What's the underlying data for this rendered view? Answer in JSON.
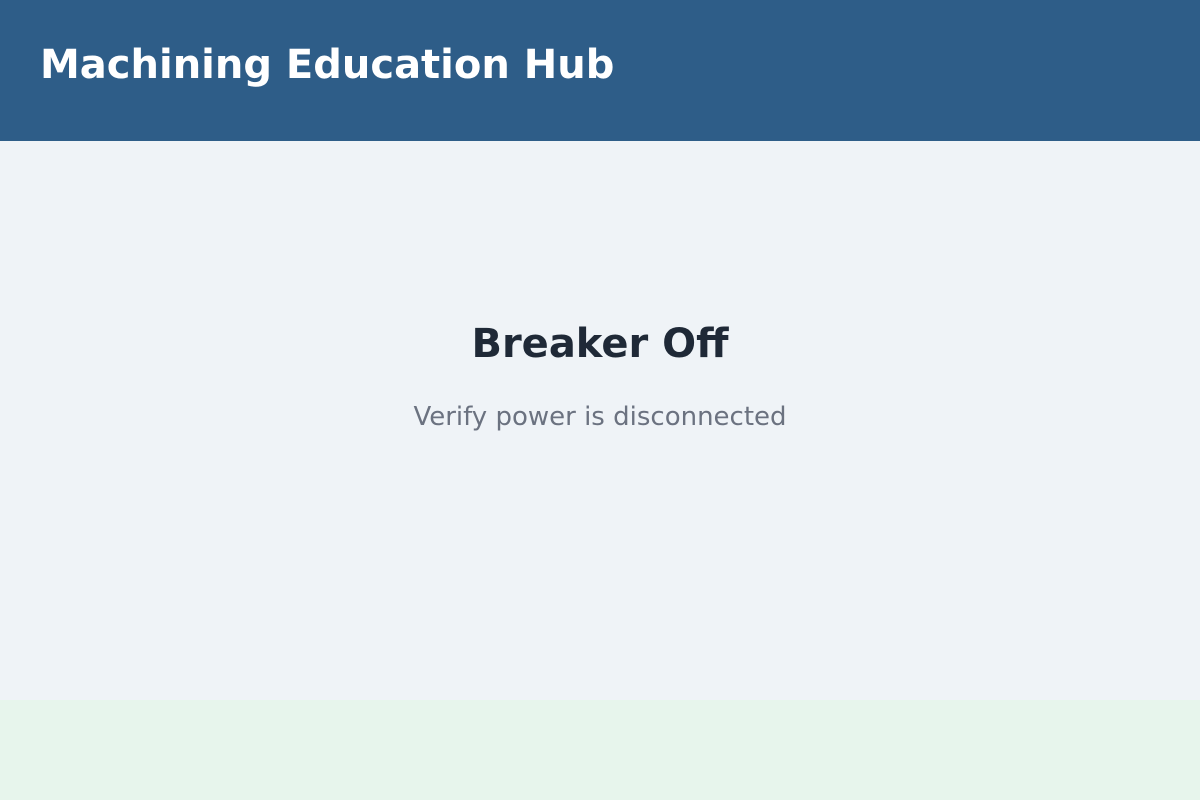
{
  "header": {
    "title": "Machining Education Hub"
  },
  "main": {
    "status_title": "Breaker Off",
    "status_message": "Verify power is disconnected"
  },
  "colors": {
    "header_background": "#2e5d88",
    "page_background": "#eff3f7",
    "footer_background": "#e7f5ec",
    "title_text": "#1f2937",
    "message_text": "#6b7280"
  }
}
